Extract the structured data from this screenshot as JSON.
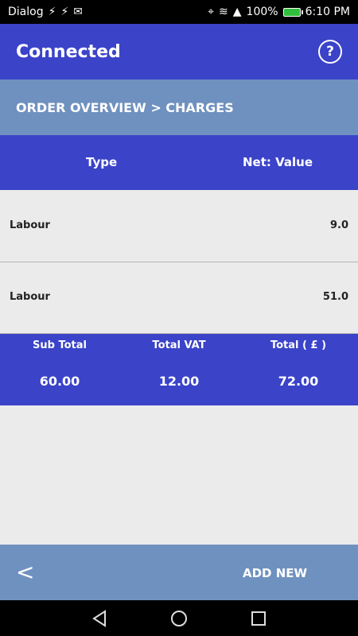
{
  "status_bar": {
    "carrier": "Dialog",
    "battery_percent": "100%",
    "time": "6:10 PM"
  },
  "app_bar": {
    "title": "Connected",
    "help_icon": "question-circle-icon"
  },
  "breadcrumb": "ORDER OVERVIEW > CHARGES",
  "table": {
    "headers": {
      "type": "Type",
      "value": "Net: Value"
    },
    "rows": [
      {
        "type": "Labour",
        "value": "9.0"
      },
      {
        "type": "Labour",
        "value": "51.0"
      }
    ]
  },
  "totals": {
    "sub_total": {
      "label": "Sub Total",
      "value": "60.00"
    },
    "total_vat": {
      "label": "Total VAT",
      "value": "12.00"
    },
    "total": {
      "label": "Total ( £ )",
      "value": "72.00"
    }
  },
  "footer": {
    "back_label": "<",
    "add_new_label": "ADD NEW"
  },
  "colors": {
    "primary": "#3b43c9",
    "secondary": "#6f91bf",
    "background": "#ebebeb"
  }
}
